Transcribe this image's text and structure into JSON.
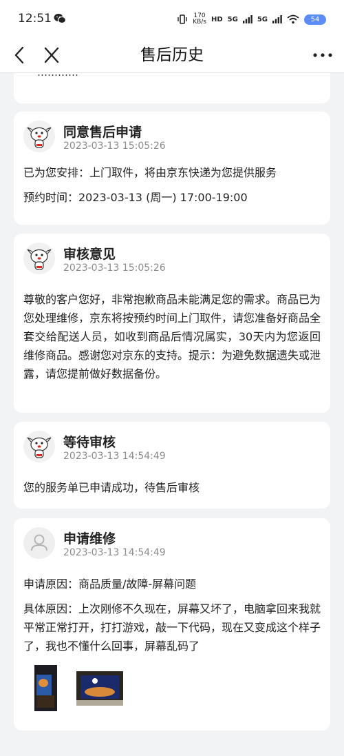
{
  "status_bar": {
    "time": "12:51",
    "net_speed_value": "170",
    "net_speed_unit": "KB/s",
    "hd_label": "HD",
    "sig1_label": "5G",
    "sig2_label": "5G",
    "battery": "54"
  },
  "nav": {
    "title": "售后历史"
  },
  "partial_top": {
    "text": "…………"
  },
  "records": [
    {
      "title": "同意售后申请",
      "time": "2023-03-13 15:05:26",
      "line1": "已为您安排：上门取件，将由京东快递为您提供服务",
      "line2": "预约时间：2023-03-13 (周一) 17:00-19:00"
    },
    {
      "title": "审核意见",
      "time": "2023-03-13 15:05:26",
      "body": "尊敬的客户您好，非常抱歉商品未能满足您的需求。商品已为您处理维修，京东将按预约时间上门取件，请您准备好商品全套交给配送人员，如收到商品后情况属实，30天内为您返回维修商品。感谢您对京东的支持。提示：为避免数据遗失或泄露，请您提前做好数据备份。"
    },
    {
      "title": "等待审核",
      "time": "2023-03-13 14:54:49",
      "body": "您的服务单已申请成功，待售后审核"
    },
    {
      "title": "申请维修",
      "time": "2023-03-13 14:54:49",
      "reason": "申请原因：商品质量/故障-屏幕问题",
      "detail": "具体原因：上次刚修不久现在，屏幕又坏了，电脑拿回来我就平常正常打开，打打游戏，敲一下代码，现在又变成这个样子了，我也不懂什么回事，屏幕乱码了"
    }
  ],
  "icons": {
    "back": "back-arrow-icon",
    "close": "close-icon",
    "more": "more-icon",
    "mascot": "jd-mascot-icon",
    "user": "user-avatar-icon"
  },
  "colors": {
    "page_bg": "#f2f3f5",
    "card_bg": "#ffffff",
    "time_text": "#8c8c8c",
    "battery": "#5b8cf7"
  }
}
